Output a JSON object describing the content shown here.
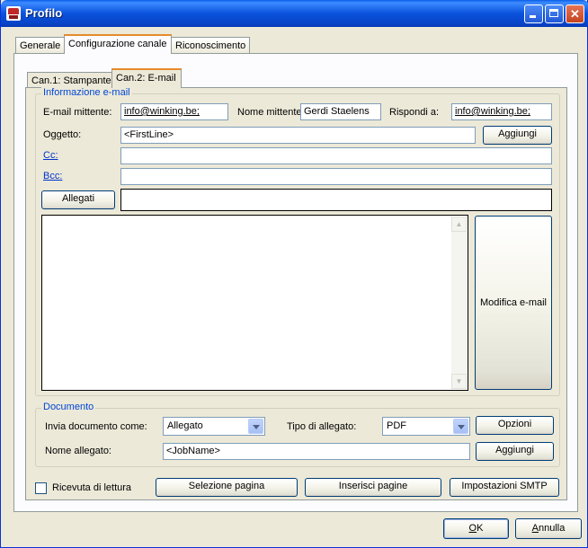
{
  "window": {
    "title": "Profilo"
  },
  "main_tabs": [
    "Generale",
    "Configurazione canale",
    "Riconoscimento"
  ],
  "sub_tabs": [
    "Can.1: Stampante",
    "Can.2: E-mail"
  ],
  "email": {
    "group_label": "Informazione e-mail",
    "sender_label": "E-mail mittente:",
    "sender_value": "info@winking.be;",
    "sender_name_label": "Nome mittente:",
    "sender_name_value": "Gerdi Staelens",
    "reply_to_label": "Rispondi a:",
    "reply_to_value": "info@winking.be;",
    "subject_label": "Oggetto:",
    "subject_value": "<FirstLine>",
    "add_label": "Aggiungi",
    "cc_label": "Cc:",
    "cc_value": "",
    "bcc_label": "Bcc:",
    "bcc_value": "",
    "attachments_button": "Allegati",
    "attachments_value": "",
    "body_value": "",
    "edit_email_button": "Modifica e-mail"
  },
  "document": {
    "group_label": "Documento",
    "send_as_label": "Invia documento come:",
    "send_as_value": "Allegato",
    "attachment_type_label": "Tipo di allegato:",
    "attachment_type_value": "PDF",
    "options_button": "Opzioni",
    "attachment_name_label": "Nome allegato:",
    "attachment_name_value": "<JobName>",
    "add_label": "Aggiungi"
  },
  "footer": {
    "read_receipt_label": "Ricevuta di lettura",
    "read_receipt_checked": false,
    "page_selection_button": "Selezione pagina",
    "insert_pages_button": "Inserisci pagine",
    "smtp_settings_button": "Impostazioni SMTP"
  },
  "dialog": {
    "ok_accel": "O",
    "ok_rest": "K",
    "cancel_accel": "A",
    "cancel_rest": "nnulla"
  }
}
